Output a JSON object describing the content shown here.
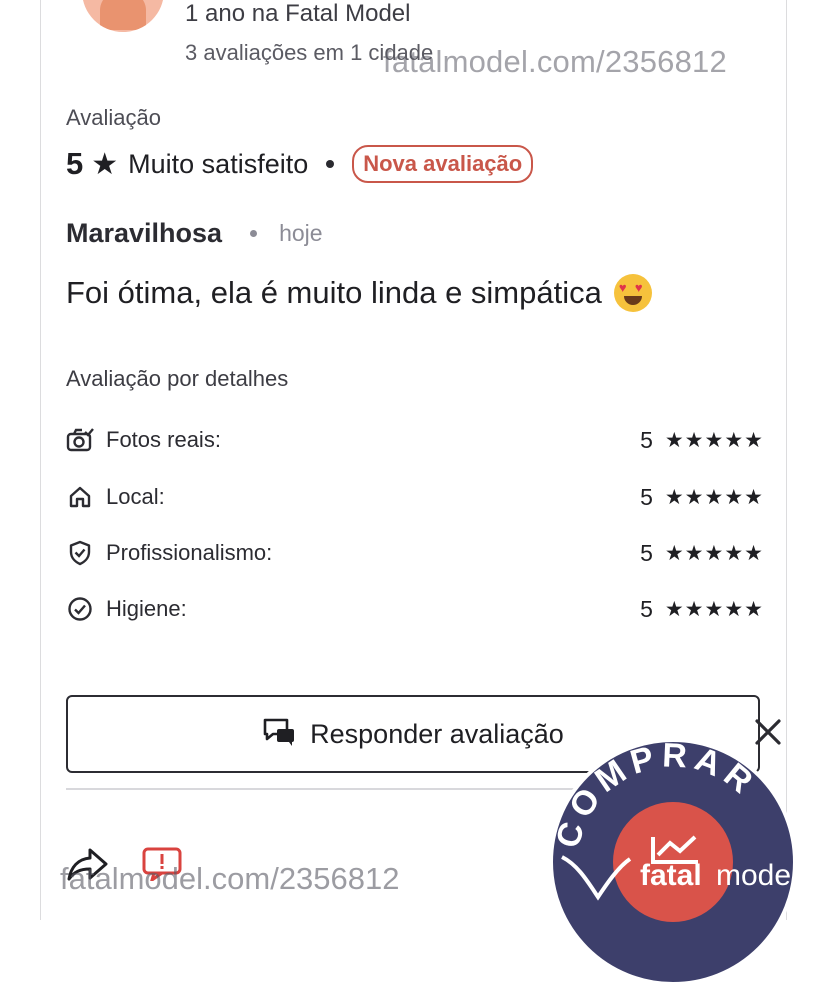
{
  "profile": {
    "member_since": "1 ano na Fatal Model",
    "reviews_summary": "3 avaliações em 1 cidade"
  },
  "watermark": {
    "top": "fatalmodel.com/2356812",
    "bottom": "fatalmodel.com/2356812"
  },
  "rating": {
    "section_label": "Avaliação",
    "score": "5",
    "text": "Muito satisfeito",
    "badge": "Nova avaliação"
  },
  "review": {
    "title": "Maravilhosa",
    "date": "hoje",
    "body": "Foi ótima, ela é muito linda e simpática"
  },
  "details": {
    "label": "Avaliação por detalhes",
    "items": [
      {
        "name": "Fotos reais:",
        "score": "5",
        "stars": "★★★★★",
        "icon": "camera-icon"
      },
      {
        "name": "Local:",
        "score": "5",
        "stars": "★★★★★",
        "icon": "home-icon"
      },
      {
        "name": "Profissionalismo:",
        "score": "5",
        "stars": "★★★★★",
        "icon": "shield-check-icon"
      },
      {
        "name": "Higiene:",
        "score": "5",
        "stars": "★★★★★",
        "icon": "check-circle-icon"
      }
    ]
  },
  "reply_button": {
    "label": "Responder avaliação"
  },
  "promo": {
    "ring_text": "COMPRAR",
    "brand_a": "fatal",
    "brand_b": "mode"
  },
  "colors": {
    "accent": "#c9574a",
    "promo_bg": "#3d3f6b",
    "promo_circle": "#d9534a"
  }
}
